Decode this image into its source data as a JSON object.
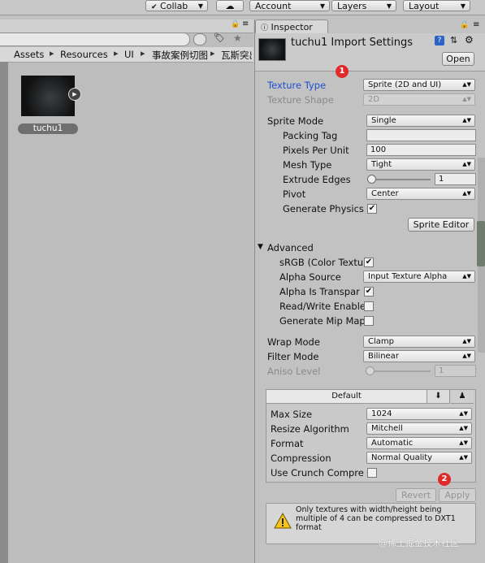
{
  "toolbar": {
    "collab": "Collab",
    "account": "Account",
    "layers": "Layers",
    "layout": "Layout"
  },
  "project": {
    "breadcrumb": [
      "Assets",
      "Resources",
      "UI",
      "事故案例切图",
      "瓦斯突出"
    ],
    "asset_name": "tuchu1"
  },
  "inspector": {
    "tab_label": "Inspector",
    "title": "tuchu1 Import Settings",
    "open_button": "Open",
    "texture_type": {
      "label": "Texture Type",
      "value": "Sprite (2D and UI)"
    },
    "texture_shape": {
      "label": "Texture Shape",
      "value": "2D"
    },
    "sprite_mode": {
      "label": "Sprite Mode",
      "value": "Single"
    },
    "packing_tag": {
      "label": "Packing Tag",
      "value": ""
    },
    "pixels_per_unit": {
      "label": "Pixels Per Unit",
      "value": "100"
    },
    "mesh_type": {
      "label": "Mesh Type",
      "value": "Tight"
    },
    "extrude_edges": {
      "label": "Extrude Edges",
      "value": "1",
      "fraction": 0.0
    },
    "pivot": {
      "label": "Pivot",
      "value": "Center"
    },
    "generate_physics": {
      "label": "Generate Physics",
      "checked": true
    },
    "sprite_editor_button": "Sprite Editor",
    "advanced": {
      "header": "Advanced",
      "srgb": {
        "label": "sRGB (Color Textu",
        "checked": true
      },
      "alpha_source": {
        "label": "Alpha Source",
        "value": "Input Texture Alpha"
      },
      "alpha_transparency": {
        "label": "Alpha Is Transpar",
        "checked": true
      },
      "read_write": {
        "label": "Read/Write Enable",
        "checked": false
      },
      "mip_maps": {
        "label": "Generate Mip Map",
        "checked": false
      }
    },
    "wrap_mode": {
      "label": "Wrap Mode",
      "value": "Clamp"
    },
    "filter_mode": {
      "label": "Filter Mode",
      "value": "Bilinear"
    },
    "aniso_level": {
      "label": "Aniso Level",
      "value": "1",
      "fraction": 0.0
    },
    "platform": {
      "tab_default": "Default",
      "max_size": {
        "label": "Max Size",
        "value": "1024"
      },
      "resize_algorithm": {
        "label": "Resize Algorithm",
        "value": "Mitchell"
      },
      "format": {
        "label": "Format",
        "value": "Automatic"
      },
      "compression": {
        "label": "Compression",
        "value": "Normal Quality"
      },
      "crunch": {
        "label": "Use Crunch Compre",
        "checked": false
      }
    },
    "revert_button": "Revert",
    "apply_button": "Apply",
    "warning": "Only textures with width/height being multiple of 4 can be compressed to DXT1 format"
  },
  "annotations": {
    "marker1": "1",
    "marker2": "2"
  },
  "watermark": "@稀土掘金技术社区"
}
